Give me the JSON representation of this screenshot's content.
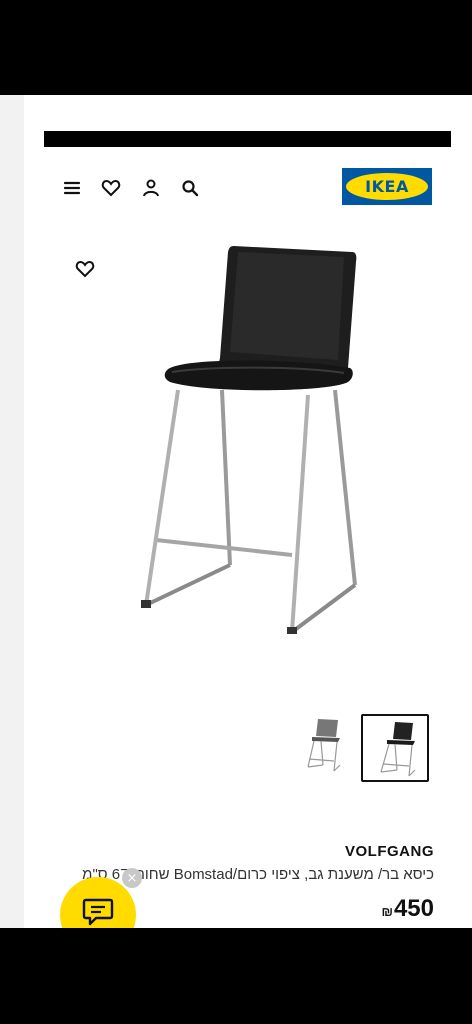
{
  "header": {
    "logo_text": "IKEA",
    "icons": [
      "menu-icon",
      "heart-icon",
      "user-icon",
      "search-icon"
    ]
  },
  "product": {
    "brand": "VOLFGANG",
    "description": "כיסא בר/ משענת גב, ציפוי כרום/Bomstad שחור, 67 ס\"מ",
    "price_value": "450",
    "currency": "₪",
    "image_count": 2,
    "selected_image": 2
  },
  "colors": {
    "ikea_blue": "#0058a3",
    "ikea_yellow": "#ffdb00"
  }
}
